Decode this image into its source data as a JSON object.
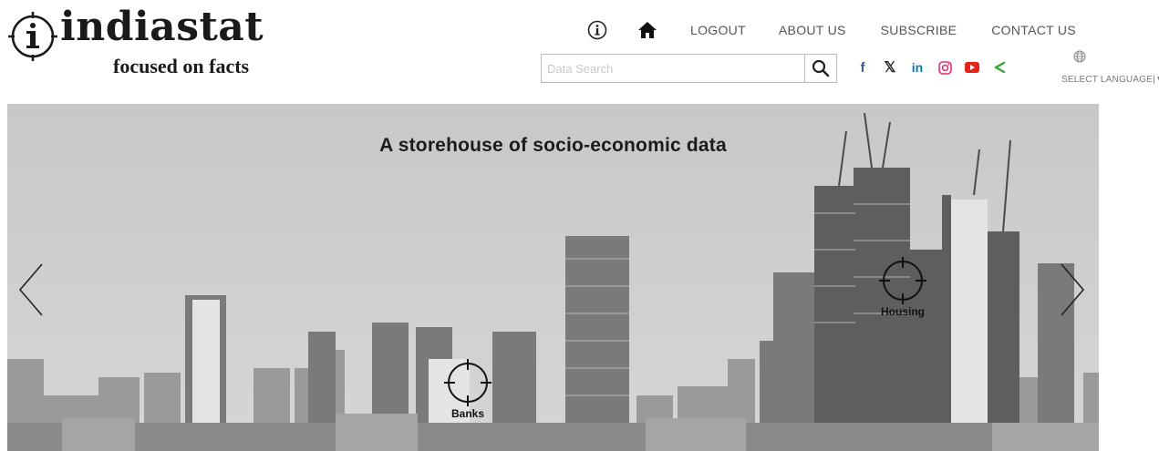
{
  "logo": {
    "name": "indiastat",
    "tagline": "focused on facts"
  },
  "nav": {
    "info_icon": "info-circle-icon",
    "home_icon": "home-icon",
    "links": [
      "LOGOUT",
      "ABOUT US",
      "SUBSCRIBE",
      "CONTACT US"
    ]
  },
  "search": {
    "placeholder": "Data Search",
    "value": "",
    "button_icon": "search-icon"
  },
  "social": [
    "facebook-icon",
    "x-icon",
    "linkedin-icon",
    "instagram-icon",
    "youtube-icon",
    "share-icon"
  ],
  "language": {
    "icon": "globe-icon",
    "label": "SELECT LANGUAGE|▼"
  },
  "banner": {
    "title": "A storehouse of socio-economic data",
    "hotspots": [
      {
        "label": "Housing"
      },
      {
        "label": "Banks"
      }
    ],
    "prev_icon": "chevron-left-icon",
    "next_icon": "chevron-right-icon"
  },
  "colors": {
    "facebook": "#3b5998",
    "linkedin": "#0e76a8",
    "instagram": "#e1306c",
    "youtube": "#e62117",
    "share": "#3aa335"
  }
}
